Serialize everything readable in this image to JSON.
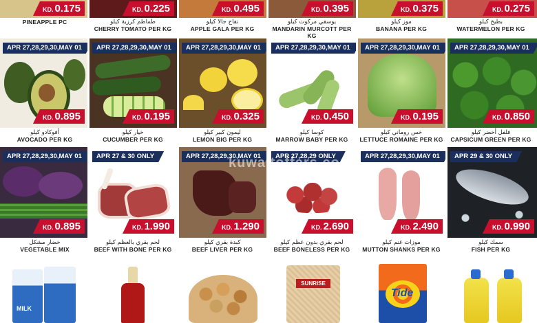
{
  "row1": [
    {
      "price": "0.175",
      "kd": "KD.",
      "name_en": "PINEAPPLE PC",
      "name_ar": ""
    },
    {
      "price": "0.225",
      "kd": "KD.",
      "name_en": "CHERRY TOMATO PER KG",
      "name_ar": "طماطم كرزية كيلو"
    },
    {
      "price": "0.495",
      "kd": "KD.",
      "name_en": "APPLE GALA PER KG",
      "name_ar": "تفاح جالا كيلو"
    },
    {
      "price": "0.395",
      "kd": "KD.",
      "name_en": "MANDARIN MURCOTT PER KG",
      "name_ar": "يوسفي مركوت كيلو"
    },
    {
      "price": "0.375",
      "kd": "KD.",
      "name_en": "BANANA PER KG",
      "name_ar": "موز كيلو"
    },
    {
      "price": "0.275",
      "kd": "KD.",
      "name_en": "WATERMELON PER KG",
      "name_ar": "بطيخ كيلو"
    }
  ],
  "row2": [
    {
      "date": "APR 27,28,29,30,MAY 01",
      "price": "0.895",
      "kd": "KD.",
      "name_en": "AVOCADO PER KG",
      "name_ar": "أفوكادو كيلو"
    },
    {
      "date": "APR 27,28,29,30,MAY 01",
      "price": "0.195",
      "kd": "KD.",
      "name_en": "CUCUMBER PER KG",
      "name_ar": "خيار كيلو"
    },
    {
      "date": "APR 27,28,29,30,MAY 01",
      "price": "0.325",
      "kd": "KD.",
      "name_en": "LEMON BIG PER KG",
      "name_ar": "ليمون كبير كيلو"
    },
    {
      "date": "APR 27,28,29,30,MAY 01",
      "price": "0.450",
      "kd": "KD.",
      "name_en": "MARROW BABY PER KG",
      "name_ar": "كوسا كيلو"
    },
    {
      "date": "APR 27,28,29,30,MAY 01",
      "price": "0.195",
      "kd": "KD.",
      "name_en": "LETTUCE ROMAINE PER KG",
      "name_ar": "خس روماني كيلو"
    },
    {
      "date": "APR 27,28,29,30,MAY 01",
      "price": "0.850",
      "kd": "KD.",
      "name_en": "CAPSICUM GREEN PER KG",
      "name_ar": "فلفل أخضر كيلو"
    }
  ],
  "row3": [
    {
      "date": "APR 27,28,29,30,MAY 01",
      "price": "0.895",
      "kd": "KD.",
      "name_en": "VEGETABLE MIX",
      "name_ar": "خضار مشكل"
    },
    {
      "date": "APR 27 & 30 ONLY",
      "price": "1.990",
      "kd": "KD.",
      "name_en": "BEEF WITH BONE PER KG",
      "name_ar": "لحم بقري بالعظم كيلو"
    },
    {
      "date": "APR 27,28,29,30,MAY 01",
      "price": "1.290",
      "kd": "KD.",
      "name_en": "BEEF LIVER PER KG",
      "name_ar": "كبدة بقري كيلو"
    },
    {
      "date": "APR 27,28,29 ONLY",
      "price": "2.690",
      "kd": "KD.",
      "name_en": "BEEF BONELESS PER KG",
      "name_ar": "لحم بقري بدون عظم كيلو"
    },
    {
      "date": "APR 27,28,29,30,MAY 01",
      "price": "2.490",
      "kd": "KD.",
      "name_en": "MUTTON SHANKS PER KG",
      "name_ar": "موزات غنم كيلو"
    },
    {
      "date": "APR 29 & 30 ONLY",
      "price": "0.990",
      "kd": "KD.",
      "name_en": "FISH PER KG",
      "name_ar": "سمك كيلو"
    }
  ],
  "row4": {
    "tide_brand": "Tide",
    "milk_brand": "MILK",
    "bag_brand": "SUNRISE"
  },
  "watermark": "kuwaitoffers.com"
}
